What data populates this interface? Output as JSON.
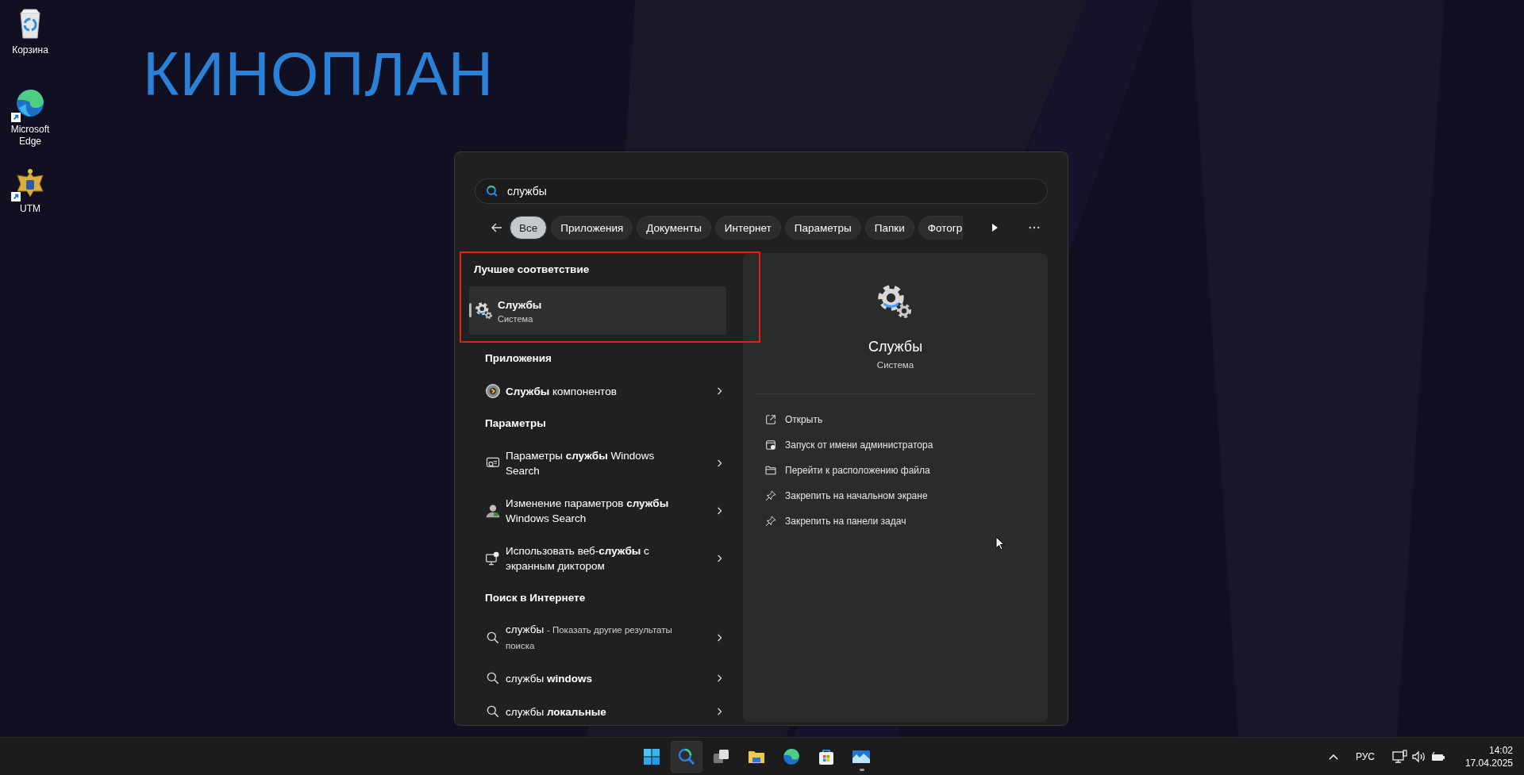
{
  "desktop": {
    "wallpaper_text": "КИНОПЛАН",
    "icons": [
      {
        "kind": "recycle-bin",
        "label": "Корзина",
        "shortcut": false
      },
      {
        "kind": "browser",
        "label": "Microsoft Edge",
        "shortcut": true
      },
      {
        "kind": "emblem",
        "label": "UTM",
        "shortcut": true
      }
    ]
  },
  "search_panel": {
    "query": "службы",
    "filters": [
      {
        "label": "Все",
        "selected": true
      },
      {
        "label": "Приложения",
        "selected": false
      },
      {
        "label": "Документы",
        "selected": false
      },
      {
        "label": "Интернет",
        "selected": false
      },
      {
        "label": "Параметры",
        "selected": false
      },
      {
        "label": "Папки",
        "selected": false
      },
      {
        "label": "Фотогр",
        "selected": false
      }
    ],
    "sections": [
      {
        "title": "Лучшее соответствие",
        "highlighted": true,
        "items": [
          {
            "kind": "gears",
            "title": "Службы",
            "subtitle": "Система",
            "selected": true,
            "arrow": false
          }
        ]
      },
      {
        "title": "Приложения",
        "highlighted": false,
        "items": [
          {
            "kind": "component",
            "title": "**Службы** компонентов",
            "selected": false,
            "arrow": true
          }
        ]
      },
      {
        "title": "Параметры",
        "highlighted": false,
        "items": [
          {
            "kind": "search-settings",
            "title": "Параметры **службы** Windows Search",
            "selected": false,
            "arrow": true
          },
          {
            "kind": "user-settings",
            "title": "Изменение параметров **службы** Windows Search",
            "selected": false,
            "arrow": true
          },
          {
            "kind": "narrator",
            "title": "Использовать веб-**службы** с экранным диктором",
            "selected": false,
            "arrow": true
          }
        ]
      },
      {
        "title": "Поиск в Интернете",
        "highlighted": false,
        "items": [
          {
            "kind": "search",
            "title": "службы",
            "subtitle": "- Показать другие результаты поиска",
            "selected": false,
            "arrow": true
          },
          {
            "kind": "search",
            "title": "службы **windows**",
            "selected": false,
            "arrow": true
          },
          {
            "kind": "search",
            "title": "службы **локальные**",
            "selected": false,
            "arrow": true
          }
        ]
      }
    ],
    "preview": {
      "title": "Службы",
      "subtitle": "Система",
      "actions": [
        {
          "kind": "open",
          "label": "Открыть"
        },
        {
          "kind": "admin",
          "label": "Запуск от имени администратора"
        },
        {
          "kind": "folder",
          "label": "Перейти к расположению файла"
        },
        {
          "kind": "pin",
          "label": "Закрепить на начальном экране"
        },
        {
          "kind": "pin",
          "label": "Закрепить на панели задач"
        }
      ]
    }
  },
  "taskbar": {
    "apps": [
      {
        "kind": "start",
        "selected": false,
        "running": false
      },
      {
        "kind": "search",
        "selected": true,
        "running": false
      },
      {
        "kind": "task-view",
        "selected": false,
        "running": false
      },
      {
        "kind": "folder",
        "selected": false,
        "running": false
      },
      {
        "kind": "browser",
        "selected": false,
        "running": false
      },
      {
        "kind": "store",
        "selected": false,
        "running": false
      },
      {
        "kind": "photos",
        "selected": false,
        "running": true
      }
    ],
    "tray": {
      "language": "РУС",
      "time": "14:02",
      "date": "17.04.2025"
    }
  }
}
